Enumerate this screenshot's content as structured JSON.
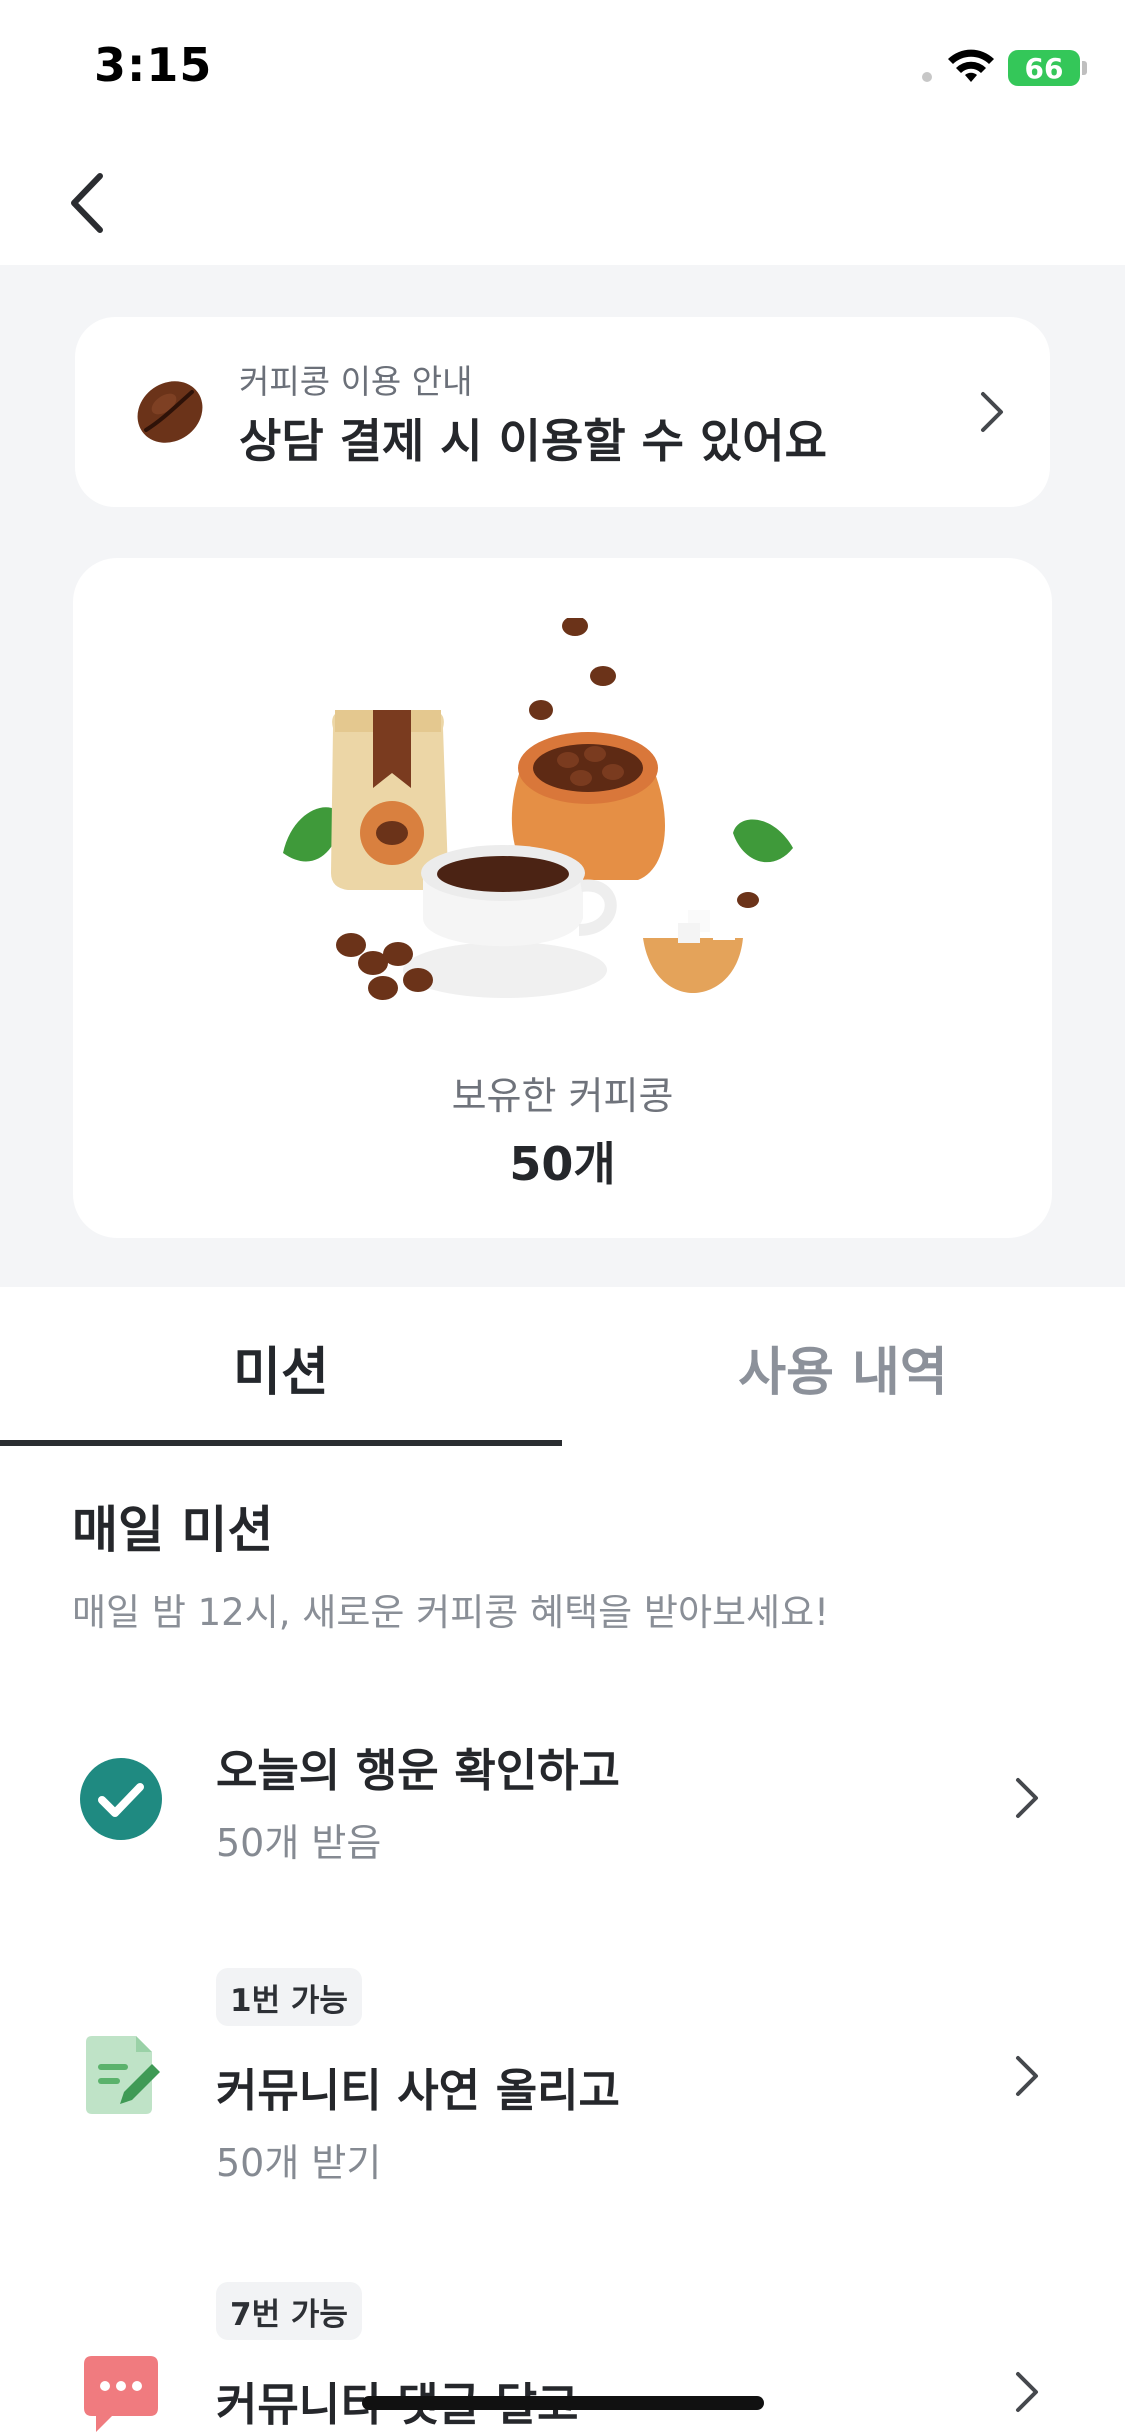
{
  "status_bar": {
    "time": "3:15",
    "battery": "66"
  },
  "info_card": {
    "subtitle": "커피콩 이용 안내",
    "title": "상담 결제 시 이용할 수 있어요"
  },
  "coupon_card": {
    "label": "보유한 커피콩",
    "count": "50개"
  },
  "tabs": [
    {
      "label": "미션",
      "selected": true
    },
    {
      "label": "사용 내역",
      "selected": false
    }
  ],
  "daily_mission": {
    "title": "매일 미션",
    "subtitle": "매일 밤 12시, 새로운 커피콩 혜택을 받아보세요!",
    "items": [
      {
        "icon": "check-circle-icon",
        "badge": "",
        "title": "오늘의 행운 확인하고",
        "reward": "50개 받음"
      },
      {
        "icon": "write-post-icon",
        "badge": "1번 가능",
        "title": "커뮤니티 사연 올리고",
        "reward": "50개 받기"
      },
      {
        "icon": "comment-bubble-icon",
        "badge": "7번 가능",
        "title": "커뮤니티 댓글 달고",
        "reward": ""
      }
    ]
  },
  "colors": {
    "check": "#1f8a81",
    "accent_green": "#34c759",
    "comment_icon": "#f07b7f"
  }
}
